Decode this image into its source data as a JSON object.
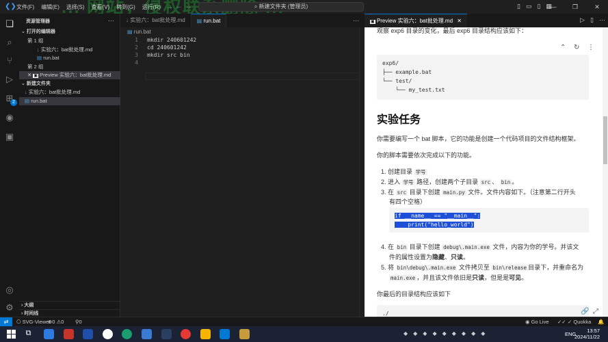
{
  "titlebar": {
    "menu": [
      "文件(F)",
      "编辑(E)",
      "选择(S)",
      "查看(V)",
      "转到(G)",
      "运行(R)",
      "..."
    ],
    "search": "新建文件夹 (管理员)",
    "watermark": "... 网站，侵权联系删除 ..."
  },
  "activity_bar": {
    "extensions_badge": "2"
  },
  "sidebar": {
    "title": "资源管理器",
    "open_editors": "打开的编辑器",
    "group1": "第 1 组",
    "group1_items": [
      "实验六：bat批处理.md",
      "run.bat"
    ],
    "group2": "第 2 组",
    "group2_items": [
      "Preview 实验六：bat批处理.md"
    ],
    "folder": "新建文件夹",
    "folder_items": [
      "实验六：bat批处理.md",
      "run.bat"
    ],
    "outline": "大纲",
    "timeline": "时间线"
  },
  "editor": {
    "tabs": [
      "实验六：bat批处理.md",
      "run.bat"
    ],
    "breadcrumb": "run.bat",
    "lines": [
      {
        "n": "1",
        "code": "mkdir 240601242"
      },
      {
        "n": "2",
        "code": "cd 240601242"
      },
      {
        "n": "3",
        "code": "mkdir src bin"
      },
      {
        "n": "4",
        "code": ""
      }
    ]
  },
  "preview": {
    "tab": "Preview 实验六：bat批处理.md",
    "top_text": "观察 exp6 目录的变化，最后 exp6 目录结构应该如下：",
    "tree1": [
      "exp6/",
      "├── example.bat",
      "└── test/",
      "    └── my_test.txt"
    ],
    "heading": "实验任务",
    "para1": "你需要编写一个 bat 脚本，它的功能是创建一个代码项目的文件结构框架。",
    "para2": "你的脚本需要依次完成以下的功能。",
    "list": {
      "i1_num": "1.",
      "i1_a": "创建目录",
      "i1_code": "学号",
      "i2_num": "2.",
      "i2_a": "进入",
      "i2_code1": "学号",
      "i2_b": "路径，创建两个子目录",
      "i2_code2": "src",
      "i2_c": "、",
      "i2_code3": "bin",
      "i2_d": "。",
      "i3_num": "3.",
      "i3_a": "在",
      "i3_code1": "src",
      "i3_b": "目录下创建",
      "i3_code2": "main.py",
      "i3_c": "文件。文件内容如下。（注意第二行开头",
      "i3_d": "有四个空格）",
      "py_code": [
        "if __name__ == \"__main__\":",
        "    print(\"hello_world\")"
      ],
      "i4_num": "4.",
      "i4_a": "在",
      "i4_code1": "bin",
      "i4_b": "目录下创建",
      "i4_code2": "debug\\.main.exe",
      "i4_c": "文件，内容为你的学号。并该文",
      "i4_d": "件的属性设置为",
      "i4_e": "隐藏",
      "i4_f": "、",
      "i4_g": "只读",
      "i4_h": "。",
      "i5_num": "5.",
      "i5_a": "将",
      "i5_code1": "bin\\debug\\.main.exe",
      "i5_b": "文件拷贝至",
      "i5_code2": "bin\\release",
      "i5_c": "目录下，并重命名为",
      "i5_code3": "main.exe",
      "i5_d": "，并且该文件依旧是",
      "i5_e": "只读",
      "i5_f": "，但是是",
      "i5_g": "可见",
      "i5_h": "。"
    },
    "para3": "你最后的目录结构应该如下",
    "tree2": [
      "./"
    ]
  },
  "statusbar": {
    "workspace": "SVG-Viewer",
    "errors": "0",
    "warnings": "0",
    "info": "0",
    "golive": "Go Live",
    "quokka": "Quokka"
  },
  "taskbar": {
    "lang": "ENG",
    "time": "13:57",
    "date": "2024/11/22"
  }
}
